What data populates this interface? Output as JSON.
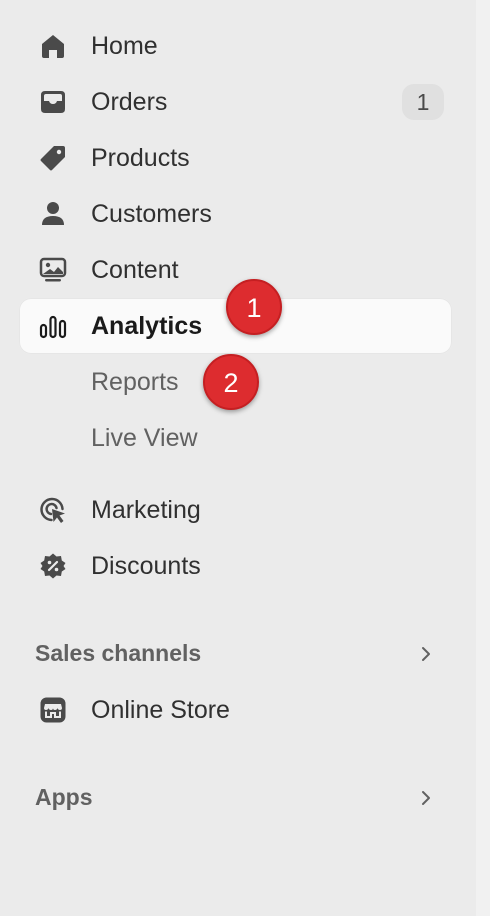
{
  "nav": {
    "items": [
      {
        "label": "Home",
        "icon": "home-icon"
      },
      {
        "label": "Orders",
        "icon": "inbox-icon",
        "badge": "1"
      },
      {
        "label": "Products",
        "icon": "tag-icon"
      },
      {
        "label": "Customers",
        "icon": "person-icon"
      },
      {
        "label": "Content",
        "icon": "image-icon"
      },
      {
        "label": "Analytics",
        "icon": "bar-chart-icon",
        "active": true
      },
      {
        "label": "Marketing",
        "icon": "target-cursor-icon"
      },
      {
        "label": "Discounts",
        "icon": "discount-icon"
      }
    ],
    "analytics_subitems": [
      {
        "label": "Reports"
      },
      {
        "label": "Live View"
      }
    ]
  },
  "sections": {
    "sales_channels": {
      "label": "Sales channels",
      "items": [
        {
          "label": "Online Store",
          "icon": "store-icon"
        }
      ]
    },
    "apps": {
      "label": "Apps"
    }
  },
  "markers": [
    {
      "label": "1"
    },
    {
      "label": "2"
    }
  ],
  "colors": {
    "background": "#ebebeb",
    "active_item": "#fafafa",
    "text_primary": "#303030",
    "text_secondary": "#616161",
    "badge_bg": "#e0e0e0",
    "marker_red": "#dd2c2f"
  }
}
